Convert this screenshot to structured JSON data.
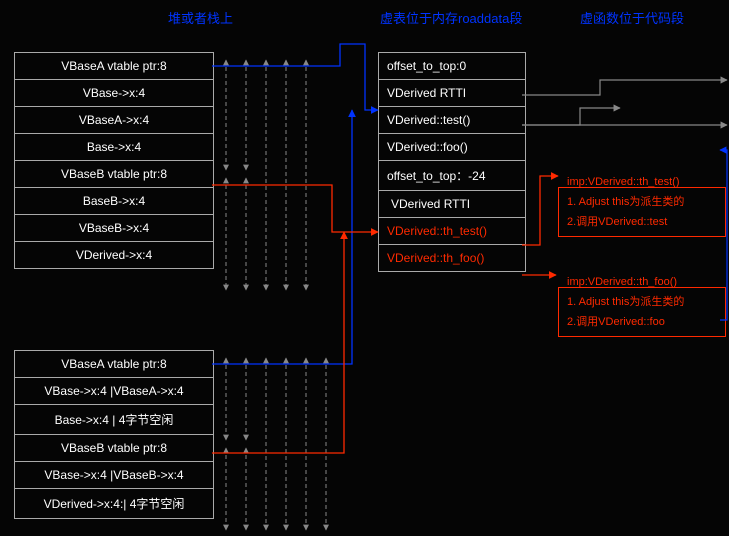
{
  "headers": {
    "col1": "堆或者栈上",
    "col2": "虚表位于内存roaddata段",
    "col3": "虚函数位于代码段"
  },
  "obj1": {
    "r0": "VBaseA vtable ptr:8",
    "r1": "VBase->x:4",
    "r2": "VBaseA->x:4",
    "r3": "Base->x:4",
    "r4": "VBaseB vtable ptr:8",
    "r5": "BaseB->x:4",
    "r6": "VBaseB->x:4",
    "r7": "VDerived->x:4"
  },
  "vtable": {
    "r0": "offset_to_top:0",
    "r1": "VDerived RTTI",
    "r2": "VDerived::test()",
    "r3": "VDerived::foo()",
    "r4": "offset_to_top：-24",
    "r5": "VDerived RTTI",
    "r6": "VDerived::th_test()",
    "r7": "VDerived::th_foo()"
  },
  "thunk1": {
    "title": "imp:VDerived::th_test()",
    "l1": "1. Adjust this为派生类的",
    "l2": "2.调用VDerived::test"
  },
  "thunk2": {
    "title": "imp:VDerived::th_foo()",
    "l1": "1. Adjust this为派生类的",
    "l2": "2.调用VDerived::foo"
  },
  "obj2": {
    "r0": "VBaseA vtable ptr:8",
    "r1": "VBase->x:4 |VBaseA->x:4",
    "r2": "Base->x:4 | 4字节空闲",
    "r3": "VBaseB vtable ptr:8",
    "r4": "VBase->x:4 |VBaseB->x:4",
    "r5": "VDerived->x:4:| 4字节空闲"
  }
}
